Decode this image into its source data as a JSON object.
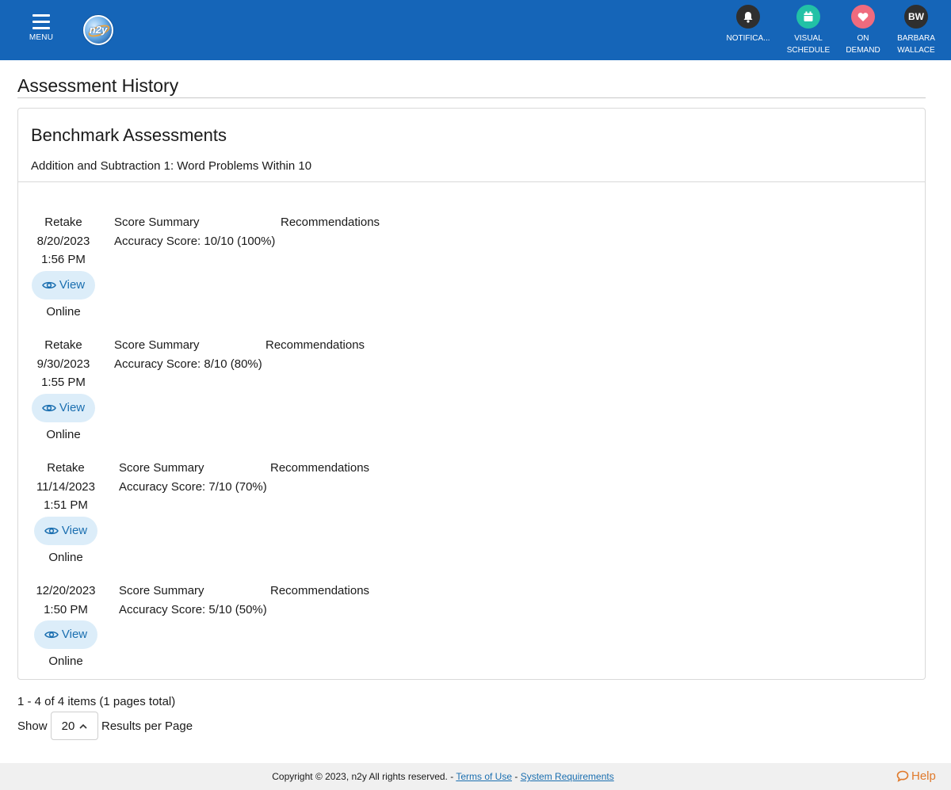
{
  "header": {
    "menu_label": "MENU",
    "logo_text": "n2y",
    "nav": [
      {
        "line1": "NOTIFICA...",
        "line2": "",
        "icon": "bell-icon",
        "color": "#2f2f2f"
      },
      {
        "line1": "VISUAL",
        "line2": "SCHEDULE",
        "icon": "calendar-icon",
        "color": "#22c1a6"
      },
      {
        "line1": "ON",
        "line2": "DEMAND",
        "icon": "heart-icon",
        "color": "#ef6b7e"
      },
      {
        "line1": "BARBARA",
        "line2": "WALLACE",
        "icon": "avatar",
        "color": "#2f2f2f",
        "initials": "BW"
      }
    ],
    "bg_color": "#1565b8"
  },
  "page_title": "Assessment History",
  "card": {
    "title": "Benchmark Assessments",
    "subtitle": "Addition and Subtraction 1: Word Problems Within 10",
    "entries": [
      {
        "label": "Retake",
        "date": "8/20/2023",
        "time": "1:56 PM",
        "view_label": "View",
        "mode": "Online",
        "score_header": "Score Summary",
        "score": "Accuracy Score: 10/10 (100%)",
        "rec_header": "Recommendations"
      },
      {
        "label": "Retake",
        "date": "9/30/2023",
        "time": "1:55 PM",
        "view_label": "View",
        "mode": "Online",
        "score_header": "Score Summary",
        "score": "Accuracy Score: 8/10 (80%)",
        "rec_header": "Recommendations"
      },
      {
        "label": "Retake",
        "date": "11/14/2023",
        "time": "1:51 PM",
        "view_label": "View",
        "mode": "Online",
        "score_header": "Score Summary",
        "score": "Accuracy Score: 7/10 (70%)",
        "rec_header": "Recommendations"
      },
      {
        "label": "",
        "date": "12/20/2023",
        "time": "1:50 PM",
        "view_label": "View",
        "mode": "Online",
        "score_header": "Score Summary",
        "score": "Accuracy Score: 5/10 (50%)",
        "rec_header": "Recommendations"
      }
    ]
  },
  "pagination": {
    "info": "1 - 4 of 4 items (1 pages total)",
    "show_label": "Show",
    "page_size": "20",
    "results_label": "Results per Page"
  },
  "footer": {
    "copyright": "Copyright © 2023, n2y All rights reserved. - ",
    "terms_link": "Terms of Use",
    "separator": " - ",
    "sysreq_link": "System Requirements",
    "help_label": "Help"
  },
  "colors": {
    "accent": "#1b6fb0",
    "view_bg": "#dcedf9",
    "help": "#e07a2c"
  }
}
